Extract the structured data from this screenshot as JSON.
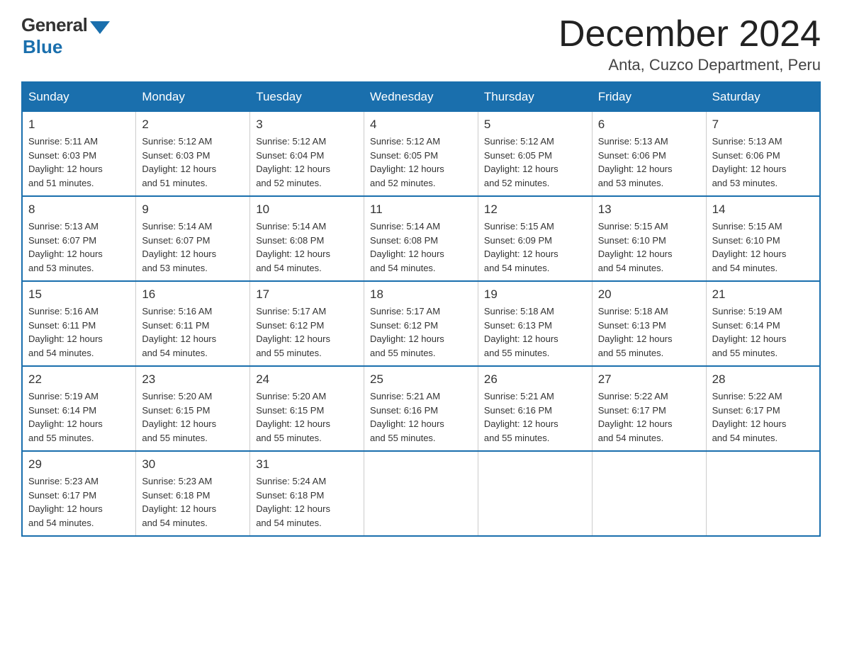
{
  "logo": {
    "general": "General",
    "blue": "Blue"
  },
  "title": {
    "month": "December 2024",
    "location": "Anta, Cuzco Department, Peru"
  },
  "headers": [
    "Sunday",
    "Monday",
    "Tuesday",
    "Wednesday",
    "Thursday",
    "Friday",
    "Saturday"
  ],
  "weeks": [
    [
      {
        "day": "1",
        "sunrise": "5:11 AM",
        "sunset": "6:03 PM",
        "daylight": "12 hours and 51 minutes."
      },
      {
        "day": "2",
        "sunrise": "5:12 AM",
        "sunset": "6:03 PM",
        "daylight": "12 hours and 51 minutes."
      },
      {
        "day": "3",
        "sunrise": "5:12 AM",
        "sunset": "6:04 PM",
        "daylight": "12 hours and 52 minutes."
      },
      {
        "day": "4",
        "sunrise": "5:12 AM",
        "sunset": "6:05 PM",
        "daylight": "12 hours and 52 minutes."
      },
      {
        "day": "5",
        "sunrise": "5:12 AM",
        "sunset": "6:05 PM",
        "daylight": "12 hours and 52 minutes."
      },
      {
        "day": "6",
        "sunrise": "5:13 AM",
        "sunset": "6:06 PM",
        "daylight": "12 hours and 53 minutes."
      },
      {
        "day": "7",
        "sunrise": "5:13 AM",
        "sunset": "6:06 PM",
        "daylight": "12 hours and 53 minutes."
      }
    ],
    [
      {
        "day": "8",
        "sunrise": "5:13 AM",
        "sunset": "6:07 PM",
        "daylight": "12 hours and 53 minutes."
      },
      {
        "day": "9",
        "sunrise": "5:14 AM",
        "sunset": "6:07 PM",
        "daylight": "12 hours and 53 minutes."
      },
      {
        "day": "10",
        "sunrise": "5:14 AM",
        "sunset": "6:08 PM",
        "daylight": "12 hours and 54 minutes."
      },
      {
        "day": "11",
        "sunrise": "5:14 AM",
        "sunset": "6:08 PM",
        "daylight": "12 hours and 54 minutes."
      },
      {
        "day": "12",
        "sunrise": "5:15 AM",
        "sunset": "6:09 PM",
        "daylight": "12 hours and 54 minutes."
      },
      {
        "day": "13",
        "sunrise": "5:15 AM",
        "sunset": "6:10 PM",
        "daylight": "12 hours and 54 minutes."
      },
      {
        "day": "14",
        "sunrise": "5:15 AM",
        "sunset": "6:10 PM",
        "daylight": "12 hours and 54 minutes."
      }
    ],
    [
      {
        "day": "15",
        "sunrise": "5:16 AM",
        "sunset": "6:11 PM",
        "daylight": "12 hours and 54 minutes."
      },
      {
        "day": "16",
        "sunrise": "5:16 AM",
        "sunset": "6:11 PM",
        "daylight": "12 hours and 54 minutes."
      },
      {
        "day": "17",
        "sunrise": "5:17 AM",
        "sunset": "6:12 PM",
        "daylight": "12 hours and 55 minutes."
      },
      {
        "day": "18",
        "sunrise": "5:17 AM",
        "sunset": "6:12 PM",
        "daylight": "12 hours and 55 minutes."
      },
      {
        "day": "19",
        "sunrise": "5:18 AM",
        "sunset": "6:13 PM",
        "daylight": "12 hours and 55 minutes."
      },
      {
        "day": "20",
        "sunrise": "5:18 AM",
        "sunset": "6:13 PM",
        "daylight": "12 hours and 55 minutes."
      },
      {
        "day": "21",
        "sunrise": "5:19 AM",
        "sunset": "6:14 PM",
        "daylight": "12 hours and 55 minutes."
      }
    ],
    [
      {
        "day": "22",
        "sunrise": "5:19 AM",
        "sunset": "6:14 PM",
        "daylight": "12 hours and 55 minutes."
      },
      {
        "day": "23",
        "sunrise": "5:20 AM",
        "sunset": "6:15 PM",
        "daylight": "12 hours and 55 minutes."
      },
      {
        "day": "24",
        "sunrise": "5:20 AM",
        "sunset": "6:15 PM",
        "daylight": "12 hours and 55 minutes."
      },
      {
        "day": "25",
        "sunrise": "5:21 AM",
        "sunset": "6:16 PM",
        "daylight": "12 hours and 55 minutes."
      },
      {
        "day": "26",
        "sunrise": "5:21 AM",
        "sunset": "6:16 PM",
        "daylight": "12 hours and 55 minutes."
      },
      {
        "day": "27",
        "sunrise": "5:22 AM",
        "sunset": "6:17 PM",
        "daylight": "12 hours and 54 minutes."
      },
      {
        "day": "28",
        "sunrise": "5:22 AM",
        "sunset": "6:17 PM",
        "daylight": "12 hours and 54 minutes."
      }
    ],
    [
      {
        "day": "29",
        "sunrise": "5:23 AM",
        "sunset": "6:17 PM",
        "daylight": "12 hours and 54 minutes."
      },
      {
        "day": "30",
        "sunrise": "5:23 AM",
        "sunset": "6:18 PM",
        "daylight": "12 hours and 54 minutes."
      },
      {
        "day": "31",
        "sunrise": "5:24 AM",
        "sunset": "6:18 PM",
        "daylight": "12 hours and 54 minutes."
      },
      null,
      null,
      null,
      null
    ]
  ],
  "labels": {
    "sunrise": "Sunrise:",
    "sunset": "Sunset:",
    "daylight": "Daylight:"
  }
}
